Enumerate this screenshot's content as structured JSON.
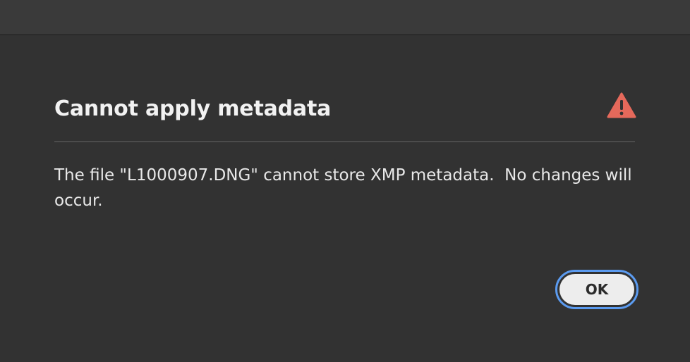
{
  "dialog": {
    "title": "Cannot apply metadata",
    "message": "The file \"L1000907.DNG\" cannot store XMP metadata.  No changes will occur.",
    "icon": "warning-icon",
    "ok_label": "OK"
  },
  "colors": {
    "background": "#323232",
    "warning": "#e5695b",
    "focus_ring": "#5b9bf0"
  }
}
